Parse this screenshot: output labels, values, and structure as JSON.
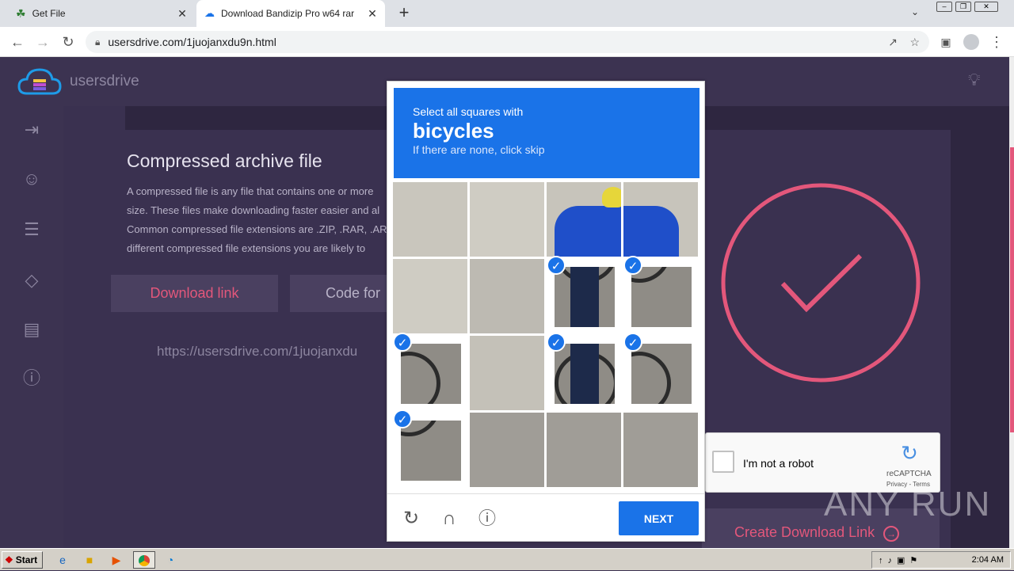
{
  "browser": {
    "tabs": [
      {
        "title": "Get File",
        "active": false
      },
      {
        "title": "Download Bandizip Pro w64 rar",
        "active": true
      }
    ],
    "new_tab_label": "+",
    "url": "usersdrive.com/1juojanxdu9n.html"
  },
  "site": {
    "logo_text": "usersdrive",
    "heading": "Compressed archive file",
    "paragraph_lines": [
      "A compressed file is any file that contains one or more",
      "size. These files make downloading faster easier and al",
      "Common compressed file extensions are .ZIP, .RAR, .AR",
      "different compressed file extensions you are likely to"
    ],
    "download_link_button": "Download link",
    "code_for_button": "Code for",
    "link_text": "https://usersdrive.com/1juojanxdu",
    "create_download_link": "Create Download Link",
    "accent_color": "#e3577b"
  },
  "captcha": {
    "instruction_line1": "Select all squares with",
    "target": "bicycles",
    "instruction_line2": "If there are none, click skip",
    "selected_tiles": [
      6,
      7,
      8,
      10,
      11,
      12
    ],
    "next_label": "NEXT",
    "reload_icon": "reload-icon",
    "audio_icon": "headphones-icon",
    "info_icon": "info-icon"
  },
  "recaptcha_widget": {
    "label": "I'm not a robot",
    "brand": "reCAPTCHA",
    "links": "Privacy - Terms"
  },
  "watermark": "ANY RUN",
  "taskbar": {
    "start_label": "Start",
    "clock": "2:04 AM"
  }
}
